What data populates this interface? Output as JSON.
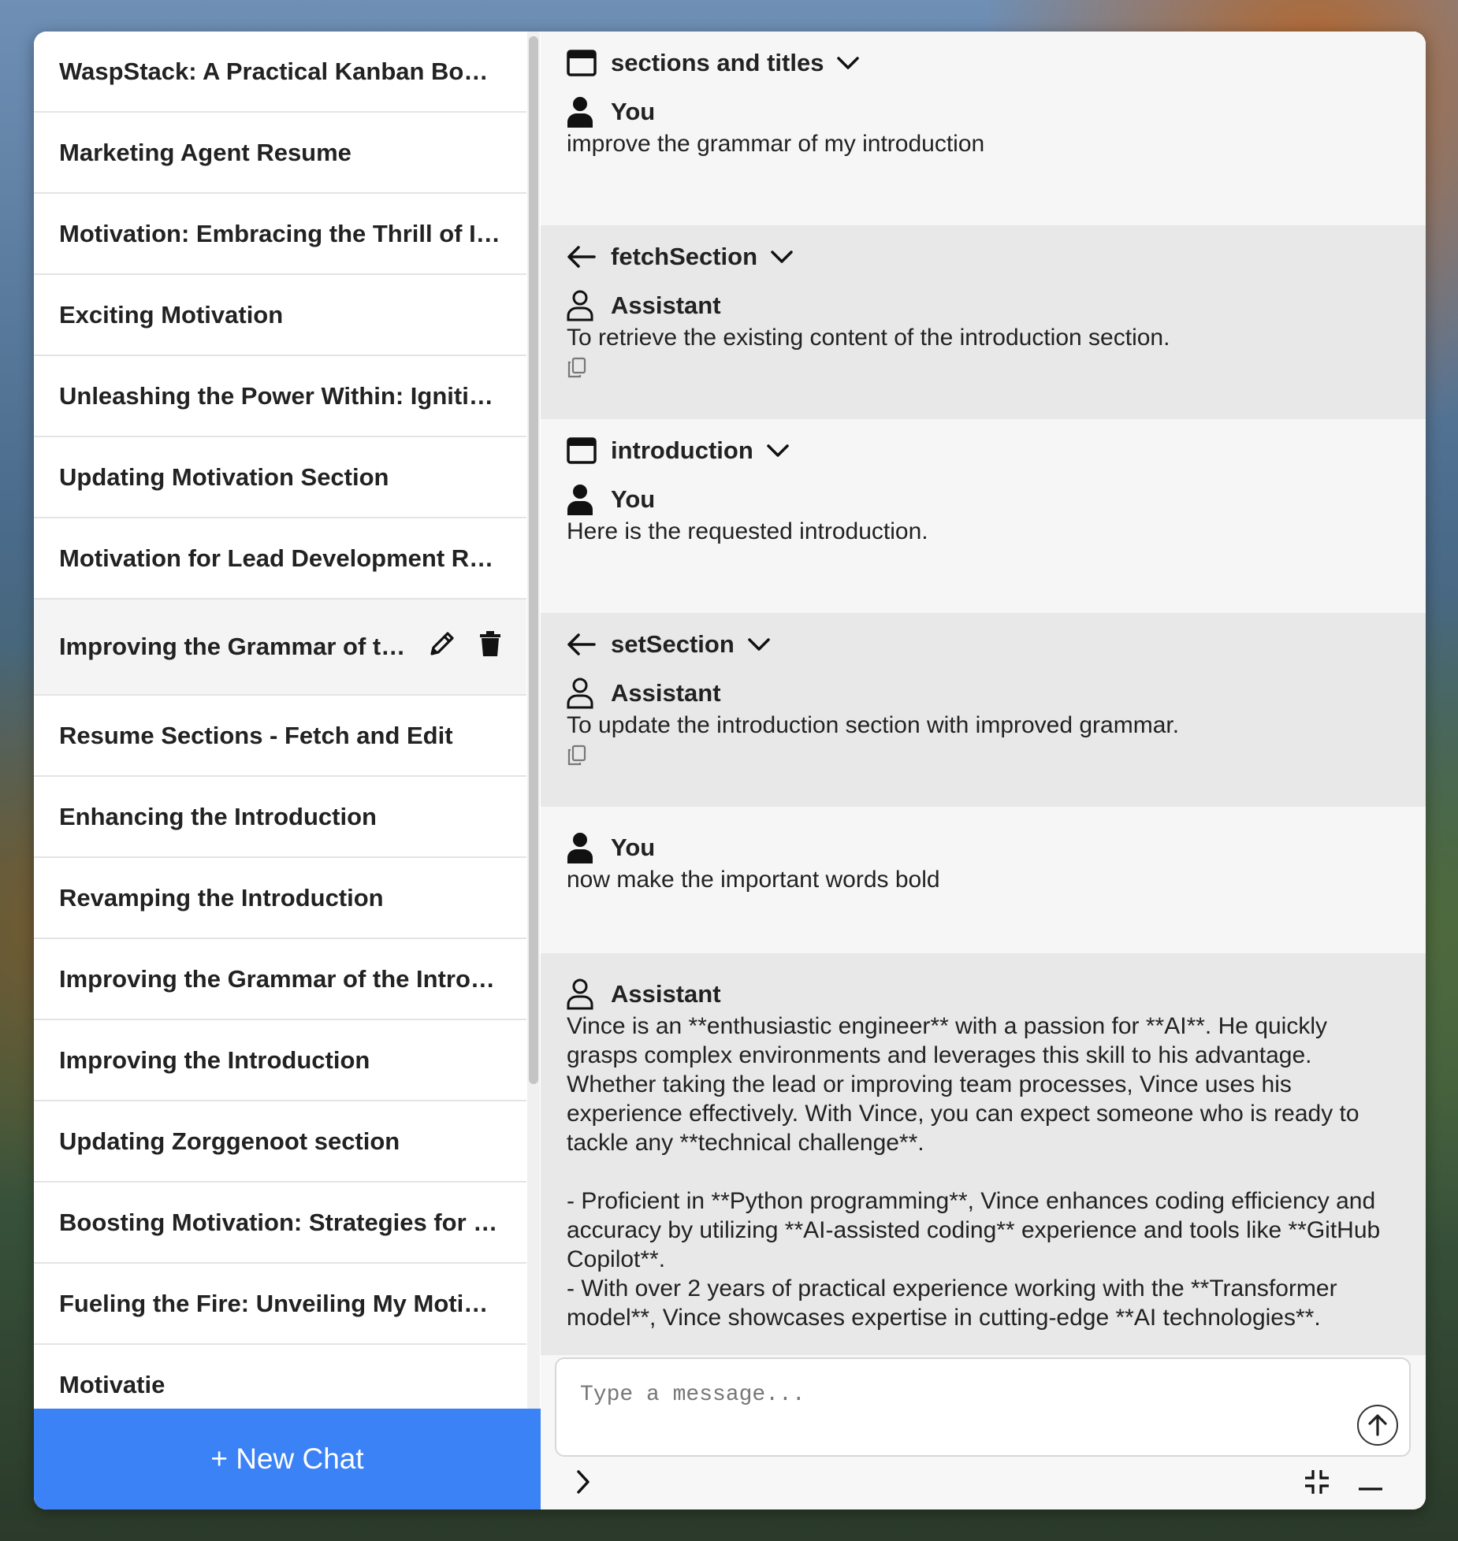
{
  "sidebar": {
    "items": [
      {
        "label": "WaspStack: A Practical Kanban Board for Developers"
      },
      {
        "label": "Marketing Agent Resume"
      },
      {
        "label": "Motivation: Embracing the Thrill of Innovation"
      },
      {
        "label": "Exciting Motivation"
      },
      {
        "label": "Unleashing the Power Within: Igniting Motivation"
      },
      {
        "label": "Updating Motivation Section"
      },
      {
        "label": "Motivation for Lead Development Role"
      },
      {
        "label": "Improving the Grammar of the Introduction"
      },
      {
        "label": "Resume Sections - Fetch and Edit"
      },
      {
        "label": "Enhancing the Introduction"
      },
      {
        "label": "Revamping the Introduction"
      },
      {
        "label": "Improving the Grammar of the Introduction"
      },
      {
        "label": "Improving the Introduction"
      },
      {
        "label": "Updating Zorggenoot section"
      },
      {
        "label": "Boosting Motivation: Strategies for Success"
      },
      {
        "label": "Fueling the Fire: Unveiling My Motivation"
      },
      {
        "label": "Motivatie"
      }
    ],
    "active_index": 7,
    "new_chat_label": "+ New Chat"
  },
  "messages": [
    {
      "tool": "sections and titles",
      "tool_icon": "window-icon",
      "author": "You",
      "author_icon": "user-solid-icon",
      "text": "improve the grammar of my introduction",
      "tone": "light"
    },
    {
      "tool": "fetchSection",
      "tool_icon": "arrow-left-icon",
      "author": "Assistant",
      "author_icon": "user-outline-icon",
      "text": "To retrieve the existing content of the introduction section.",
      "tone": "dark",
      "copy": true
    },
    {
      "tool": "introduction",
      "tool_icon": "window-icon",
      "author": "You",
      "author_icon": "user-solid-icon",
      "text": "Here is the requested introduction.",
      "tone": "light"
    },
    {
      "tool": "setSection",
      "tool_icon": "arrow-left-icon",
      "author": "Assistant",
      "author_icon": "user-outline-icon",
      "text": "To update the introduction section with improved grammar.",
      "tone": "dark",
      "copy": true
    },
    {
      "author": "You",
      "author_icon": "user-solid-icon",
      "text": "now make the important words bold",
      "tone": "light"
    },
    {
      "author": "Assistant",
      "author_icon": "user-outline-icon",
      "text": "Vince is an **enthusiastic engineer** with a passion for **AI**. He quickly grasps complex environments and leverages this skill to his advantage. Whether taking the lead or improving team processes, Vince uses his experience effectively. With Vince, you can expect someone who is ready to tackle any **technical challenge**.\n\n- Proficient in **Python programming**, Vince enhances coding efficiency and accuracy by utilizing **AI-assisted coding** experience and tools like **GitHub Copilot**.\n- With over 2 years of practical experience working with the **Transformer model**, Vince showcases expertise in cutting-edge **AI technologies**.",
      "tone": "dark"
    }
  ],
  "composer": {
    "placeholder": "Type a message..."
  }
}
